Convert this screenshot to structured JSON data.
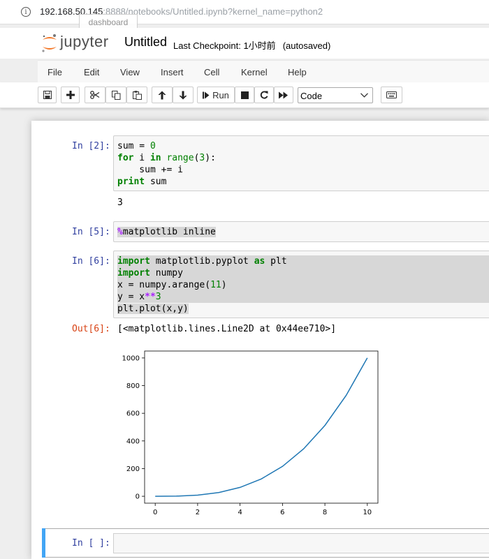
{
  "browser": {
    "url_host": "192.168.50.145",
    "url_rest": ":8888/notebooks/Untitled.ipynb?kernel_name=python2",
    "tooltip": "dashboard"
  },
  "header": {
    "logo_text": "jupyter",
    "notebook_name": "Untitled",
    "checkpoint": "Last Checkpoint: 1小时前",
    "autosave": "(autosaved)"
  },
  "menu": [
    "File",
    "Edit",
    "View",
    "Insert",
    "Cell",
    "Kernel",
    "Help"
  ],
  "toolbar": {
    "run_label": "Run",
    "cell_type": "Code"
  },
  "cells": {
    "c1": {
      "prompt": "In [2]:",
      "lines": [
        {
          "kw": "",
          "rest": "sum = ",
          "num": "0"
        },
        {
          "kw": "for",
          "mid": " i ",
          "kw2": "in",
          "sp": " ",
          "bi": "range",
          "p1": "(",
          "num": "3",
          "p2": "):"
        },
        {
          "rest": "    sum += i"
        },
        {
          "kw": "print",
          "rest": " sum"
        }
      ],
      "output": "3"
    },
    "c2": {
      "prompt": "In [5]:",
      "magic": "%",
      "rest": "matplotlib inline"
    },
    "c3": {
      "prompt": "In [6]:",
      "l1": {
        "kw": "import",
        "mid": " matplotlib.pyplot ",
        "kw2": "as",
        "rest": " plt"
      },
      "l2": {
        "kw": "import",
        "rest": " numpy"
      },
      "l3": {
        "pre": "x = numpy.arange(",
        "num": "11",
        "post": ")"
      },
      "l4": {
        "pre": "y = x",
        "op": "**",
        "num": "3"
      },
      "l5": "plt.plot(x,y)",
      "out_prompt": "Out[6]:",
      "output": "[<matplotlib.lines.Line2D at 0x44ee710>]"
    },
    "c4": {
      "prompt": "In [ ]:"
    }
  },
  "chart_data": {
    "type": "line",
    "x": [
      0,
      1,
      2,
      3,
      4,
      5,
      6,
      7,
      8,
      9,
      10
    ],
    "series": [
      {
        "values": [
          0,
          1,
          8,
          27,
          64,
          125,
          216,
          343,
          512,
          729,
          1000
        ],
        "color": "#1f77b4"
      }
    ],
    "xticks": [
      0,
      2,
      4,
      6,
      8,
      10
    ],
    "yticks": [
      0,
      200,
      400,
      600,
      800,
      1000
    ],
    "xlim": [
      -0.5,
      10.5
    ],
    "ylim": [
      -50,
      1050
    ],
    "grid": false,
    "title": "",
    "xlabel": "",
    "ylabel": ""
  }
}
